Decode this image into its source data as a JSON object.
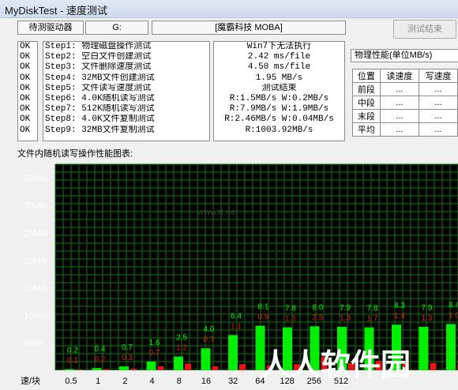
{
  "window": {
    "title": "MyDiskTest - 速度测试"
  },
  "drive_bar": {
    "label": "待测驱动器",
    "drive": "G:",
    "model": "[魔霸科技 MOBA]",
    "finish_button": "测试结束"
  },
  "status": [
    "OK",
    "OK",
    "OK",
    "OK",
    "OK",
    "OK",
    "OK",
    "OK",
    "OK"
  ],
  "steps": [
    "Step1: 物理磁盘操作测试",
    "Step2: 空白文件创建测试",
    "Step3: 文件删除速度测试",
    "Step4: 32MB文件创建测试",
    "Step5: 文件读写速度测试",
    "Step6: 4.0K随机读写测试",
    "Step7: 512K随机读写测试",
    "Step8: 4.0K文件复制测试",
    "Step9: 32MB文件复制测试"
  ],
  "results": [
    "Win7下无法执行",
    "2.42 ms/file",
    "4.50 ms/file",
    "1.95 MB/s",
    "测试结束",
    "R:1.5MB/s W:0.2MB/s",
    "R:7.9MB/s W:1.9MB/s",
    "R:2.46MB/s W:0.04MB/s",
    "R:1003.92MB/s"
  ],
  "physical_perf": {
    "title": "物理性能(单位MB/s)",
    "headers": [
      "位置",
      "读速度",
      "写速度"
    ],
    "rows": [
      {
        "pos": "前段",
        "read": "...",
        "write": "..."
      },
      {
        "pos": "中段",
        "read": "...",
        "write": "..."
      },
      {
        "pos": "末段",
        "read": "...",
        "write": "..."
      },
      {
        "pos": "平均",
        "read": "...",
        "write": "..."
      }
    ]
  },
  "chart_caption": "文件内随机读写操作性能图表:",
  "watermark": {
    "text": "人人软件园",
    "logo_text": "www.rr.net"
  },
  "colors": {
    "read": "#00ee00",
    "write": "#ee1111",
    "grid": "#0a7a0a",
    "bg": "#000000",
    "axis_text": "#000000"
  },
  "chart_data": {
    "type": "bar",
    "xlabel": "速/块",
    "categories": [
      "0.5",
      "1",
      "2",
      "4",
      "8",
      "16",
      "32",
      "64",
      "128",
      "256",
      "512"
    ],
    "ylim": [
      0,
      37.5
    ],
    "yticks": [
      "35M/s",
      "30M/s",
      "25M/s",
      "20M/s",
      "15M/s",
      "10M/s",
      "5M/s"
    ],
    "ytick_values": [
      35,
      30,
      25,
      20,
      15,
      10,
      5
    ],
    "series": [
      {
        "name": "读",
        "values": [
          0.2,
          0.4,
          0.7,
          1.6,
          2.5,
          4.0,
          6.4,
          8.1,
          7.8,
          8.0,
          7.9,
          7.8,
          8.3,
          7.9,
          8.4
        ]
      },
      {
        "name": "写",
        "values": [
          0.1,
          0.2,
          0.3,
          0.7,
          1.2,
          0.7,
          1.1,
          0.9,
          1.1,
          2.5,
          1.3,
          1.7,
          1.4,
          1.3,
          1.0
        ]
      }
    ],
    "read_labels": [
      "0.2",
      "0.4",
      "0.7",
      "1.6",
      "2.5",
      "4.0",
      "6.4",
      "8.1",
      "7.8",
      "8.0",
      "7.9",
      "7.8",
      "8.3",
      "7.9",
      "8.4"
    ],
    "write_labels": [
      "0.1",
      "0.2",
      "0.3",
      "0.7",
      "1.2",
      "0.7",
      "1.1",
      "0.9",
      "1.1",
      "2.5",
      "1.3",
      "1.7",
      "1.4",
      "1.3",
      "1.0"
    ]
  }
}
